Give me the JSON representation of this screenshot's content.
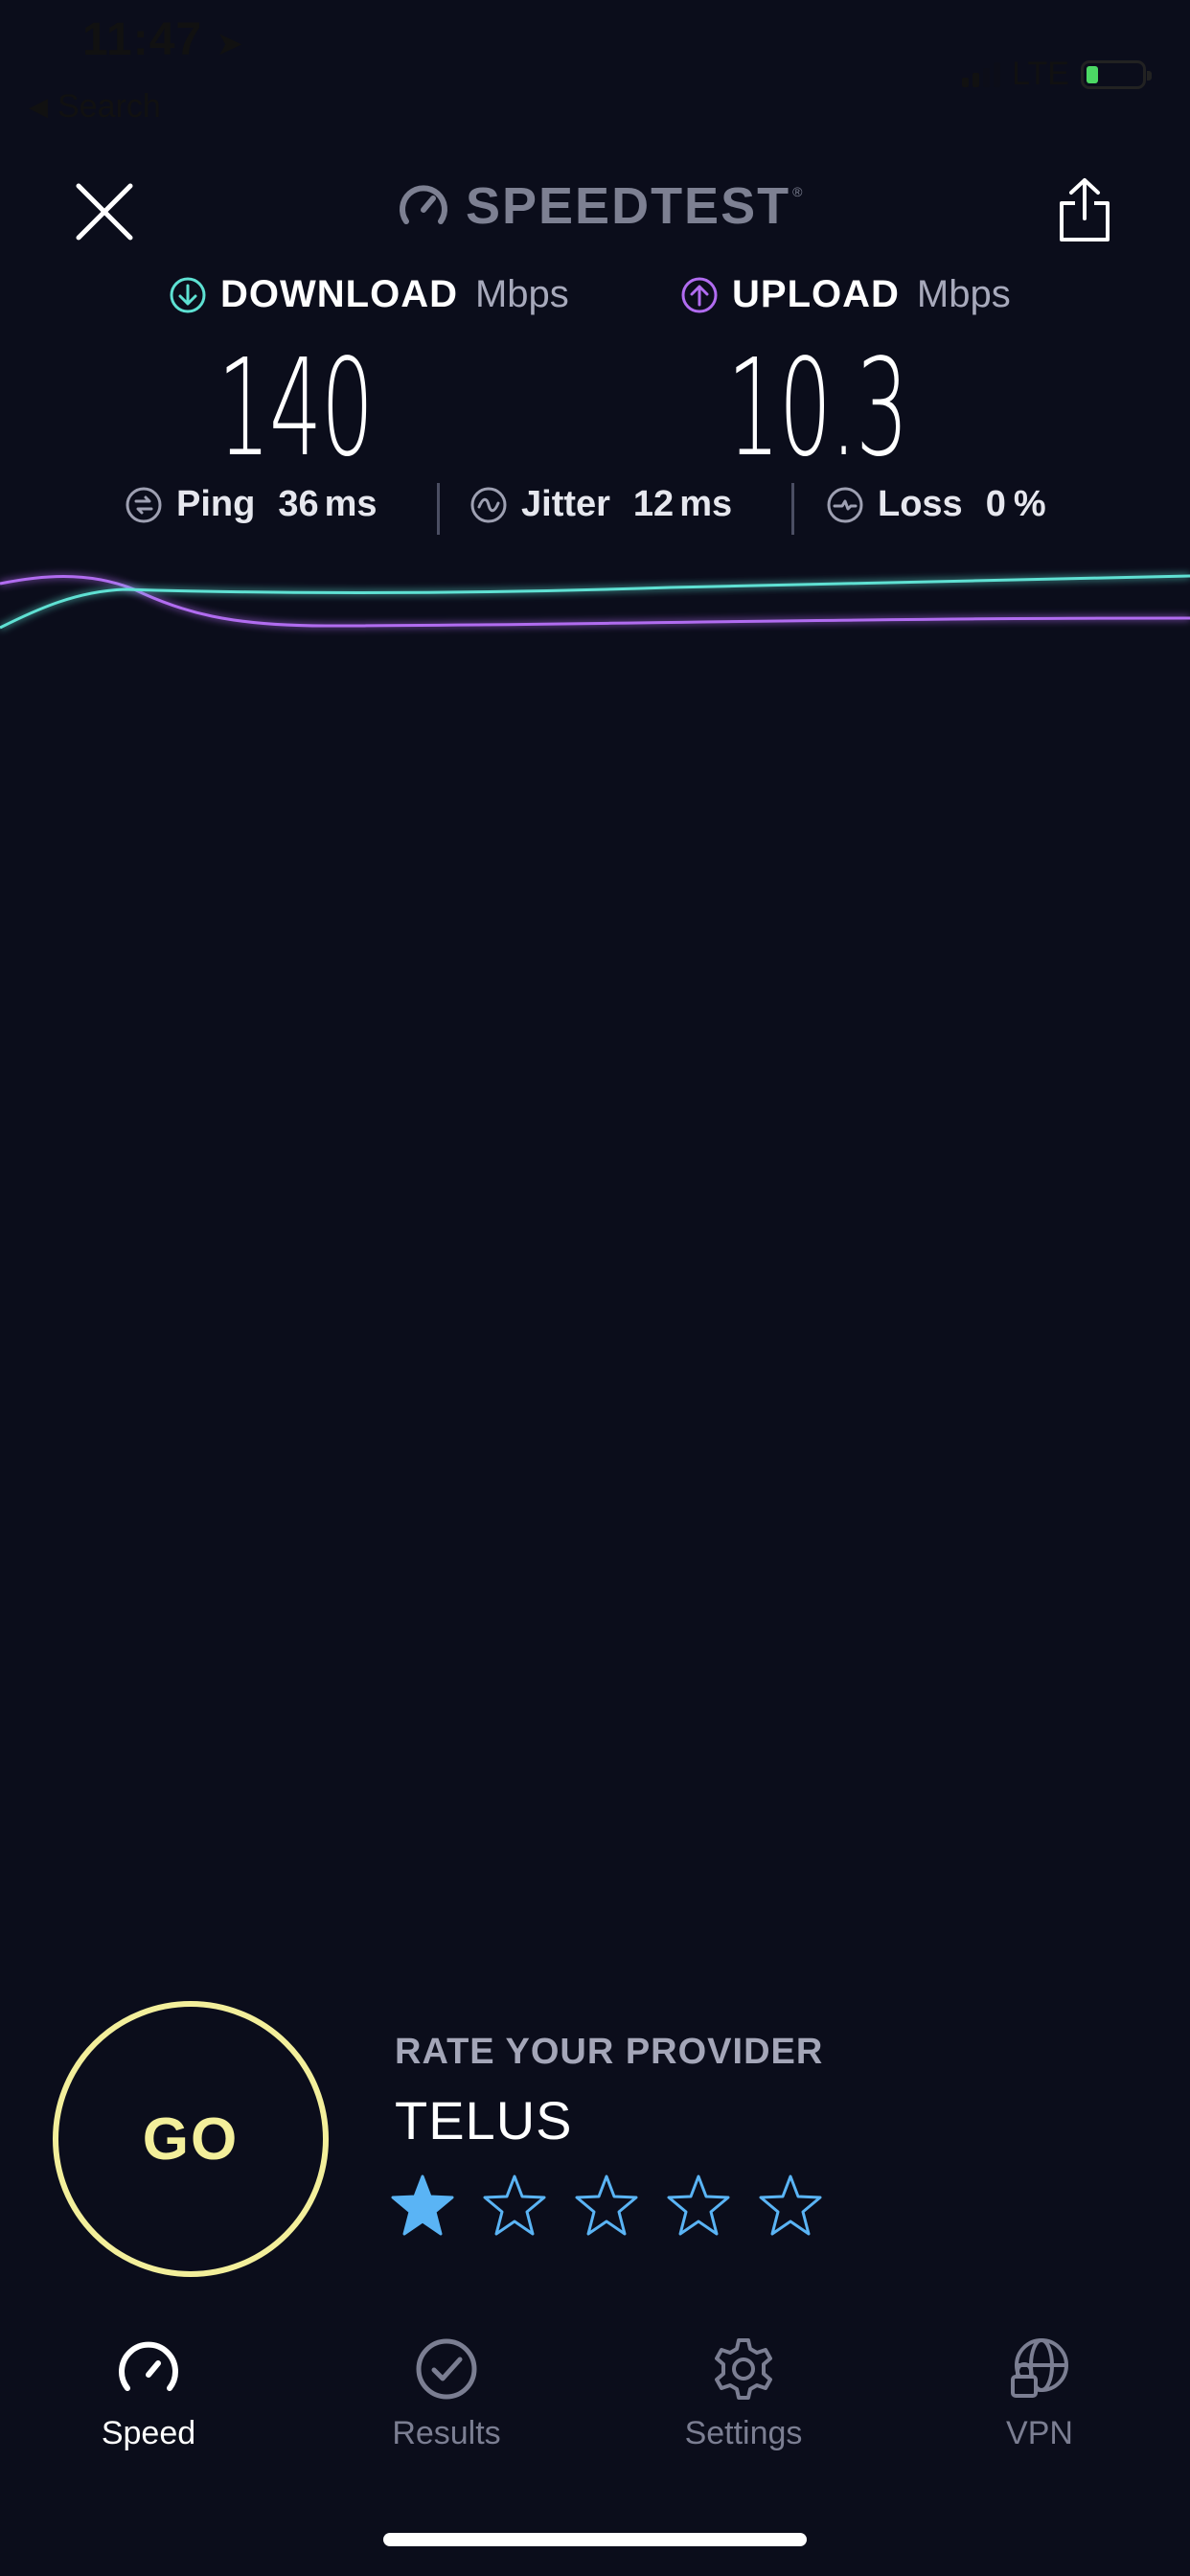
{
  "status_bar": {
    "time": "11:47",
    "back_label": "Search",
    "network": "LTE"
  },
  "header": {
    "brand": "SPEEDTEST",
    "brand_mark": "®"
  },
  "download": {
    "label": "DOWNLOAD",
    "unit": "Mbps",
    "value": "140",
    "color": "#5ee1d3"
  },
  "upload": {
    "label": "UPLOAD",
    "unit": "Mbps",
    "value": "10.3",
    "color": "#b16cf0"
  },
  "stats": {
    "ping": {
      "label": "Ping",
      "value": "36",
      "unit": "ms"
    },
    "jitter": {
      "label": "Jitter",
      "value": "12",
      "unit": "ms"
    },
    "loss": {
      "label": "Loss",
      "value": "0",
      "unit": "%"
    }
  },
  "go_button": {
    "label": "GO",
    "color": "#f3ef9b"
  },
  "rating": {
    "title": "RATE YOUR PROVIDER",
    "provider": "TELUS",
    "stars_total": 5,
    "stars_filled": 1,
    "star_color": "#5ab4f5"
  },
  "tabs": [
    {
      "label": "Speed",
      "icon": "speedometer-icon",
      "active": true
    },
    {
      "label": "Results",
      "icon": "check-circle-icon",
      "active": false
    },
    {
      "label": "Settings",
      "icon": "gear-icon",
      "active": false
    },
    {
      "label": "VPN",
      "icon": "globe-lock-icon",
      "active": false
    }
  ]
}
